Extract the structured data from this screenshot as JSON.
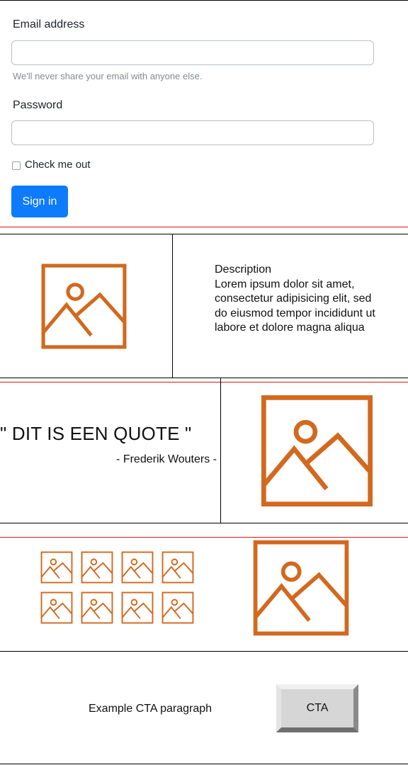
{
  "form": {
    "email_label": "Email address",
    "email_value": "",
    "email_placeholder": "",
    "email_help": "We'll never share your email with anyone else.",
    "password_label": "Password",
    "password_value": "",
    "password_placeholder": "",
    "checkbox_label": "Check me out",
    "checkbox_checked": false,
    "submit_label": "Sign in"
  },
  "media_block": {
    "image_icon": "image-placeholder-icon",
    "title": "Description",
    "text": "Lorem ipsum dolor sit amet, consectetur adipisicing elit, sed do eiusmod tempor incididunt ut labore et dolore magna aliqua"
  },
  "quote_block": {
    "quote": "\" DIT IS EEN QUOTE \"",
    "author": "- Frederik Wouters -",
    "image_icon": "image-placeholder-icon"
  },
  "gallery_block": {
    "thumbnail_count": 8,
    "thumbnail_icon": "image-placeholder-icon",
    "featured_icon": "image-placeholder-icon"
  },
  "cta_block": {
    "paragraph": "Example CTA paragraph",
    "button_label": "CTA"
  },
  "colors": {
    "primary_button": "#0d7bfd",
    "placeholder_icon": "#d2691e",
    "section_divider": "#d0191b"
  }
}
